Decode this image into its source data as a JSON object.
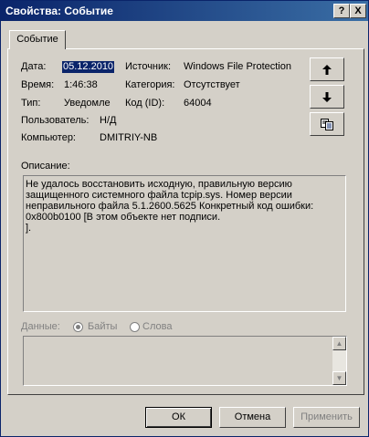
{
  "window": {
    "title": "Свойства: Событие",
    "help_glyph": "?",
    "close_glyph": "X"
  },
  "tabs": [
    {
      "label": "Событие"
    }
  ],
  "event": {
    "date_label": "Дата:",
    "date_value": "05.12.2010",
    "source_label": "Источник:",
    "source_value": "Windows File Protection",
    "time_label": "Время:",
    "time_value": "1:46:38",
    "category_label": "Категория:",
    "category_value": "Отсутствует",
    "type_label": "Тип:",
    "type_value": "Уведомле",
    "id_label": "Код (ID):",
    "id_value": "64004",
    "user_label": "Пользователь:",
    "user_value": "Н/Д",
    "computer_label": "Компьютер:",
    "computer_value": "DMITRIY-NB"
  },
  "side_buttons": {
    "up_icon": "arrow-up-icon",
    "down_icon": "arrow-down-icon",
    "copy_icon": "copy-icon"
  },
  "description": {
    "label": "Описание:",
    "lines": [
      "Не удалось восстановить исходную, правильную версию",
      "защищенного системного файла tcpip.sys. Номер версии",
      "неправильного файла 5.1.2600.5625  Конкретный код ошибки:",
      "0x800b0100 [В этом объекте нет подписи.",
      "]."
    ]
  },
  "data_section": {
    "label": "Данные:",
    "bytes_label": "Байты",
    "words_label": "Слова",
    "selected": "Байты"
  },
  "buttons": {
    "ok": "ОК",
    "cancel": "Отмена",
    "apply": "Применить"
  },
  "colors": {
    "titlebar": "#0a246a",
    "face": "#d4d0c8",
    "selection": "#0a246a"
  }
}
